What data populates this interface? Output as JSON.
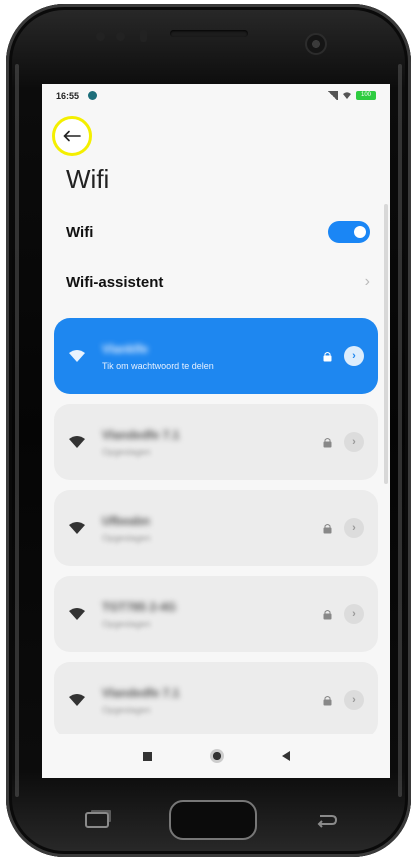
{
  "status_bar": {
    "time": "16:55",
    "battery": "100"
  },
  "header": {
    "title": "Wifi"
  },
  "settings": {
    "wifi_label": "Wifi",
    "wifi_enabled": true,
    "assistant_label": "Wifi-assistent"
  },
  "networks": [
    {
      "name": "Vlanklfe",
      "subtitle": "Tik om wachtwoord te delen",
      "connected": true
    },
    {
      "name": "Vlandedfe 7.1",
      "subtitle": "Opgeslagen",
      "connected": false
    },
    {
      "name": "Ufbeabn",
      "subtitle": "Opgeslagen",
      "connected": false
    },
    {
      "name": "TGT785 2-4G",
      "subtitle": "Opgeslagen",
      "connected": false
    },
    {
      "name": "Vlandedfe 7.1",
      "subtitle": "Opgeslagen",
      "connected": false
    }
  ],
  "colors": {
    "accent": "#1e87f0",
    "highlight_circle": "#f4ef00"
  }
}
